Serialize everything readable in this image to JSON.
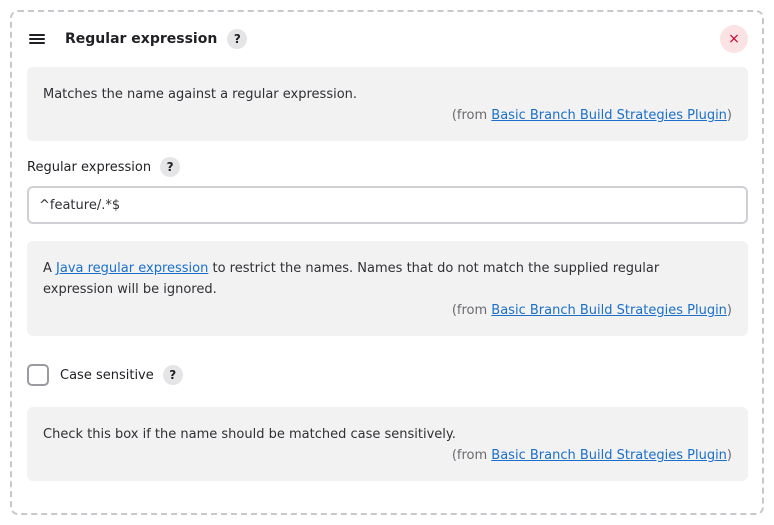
{
  "header": {
    "title": "Regular expression",
    "help_label": "?",
    "close_label": "×"
  },
  "description": {
    "text": "Matches the name against a regular expression.",
    "from_prefix": "(from ",
    "from_link": "Basic Branch Build Strategies Plugin",
    "from_suffix": ")"
  },
  "regex_field": {
    "label": "Regular expression",
    "help_label": "?",
    "value": "^feature/.*$"
  },
  "regex_help": {
    "prefix": "A ",
    "link": "Java regular expression",
    "suffix": " to restrict the names. Names that do not match the supplied regular expression will be ignored.",
    "from_prefix": "(from ",
    "from_link": "Basic Branch Build Strategies Plugin",
    "from_suffix": ")"
  },
  "case_sensitive": {
    "label": "Case sensitive",
    "help_label": "?",
    "checked": false
  },
  "case_help": {
    "text": "Check this box if the name should be matched case sensitively.",
    "from_prefix": "(from ",
    "from_link": "Basic Branch Build Strategies Plugin",
    "from_suffix": ")"
  }
}
